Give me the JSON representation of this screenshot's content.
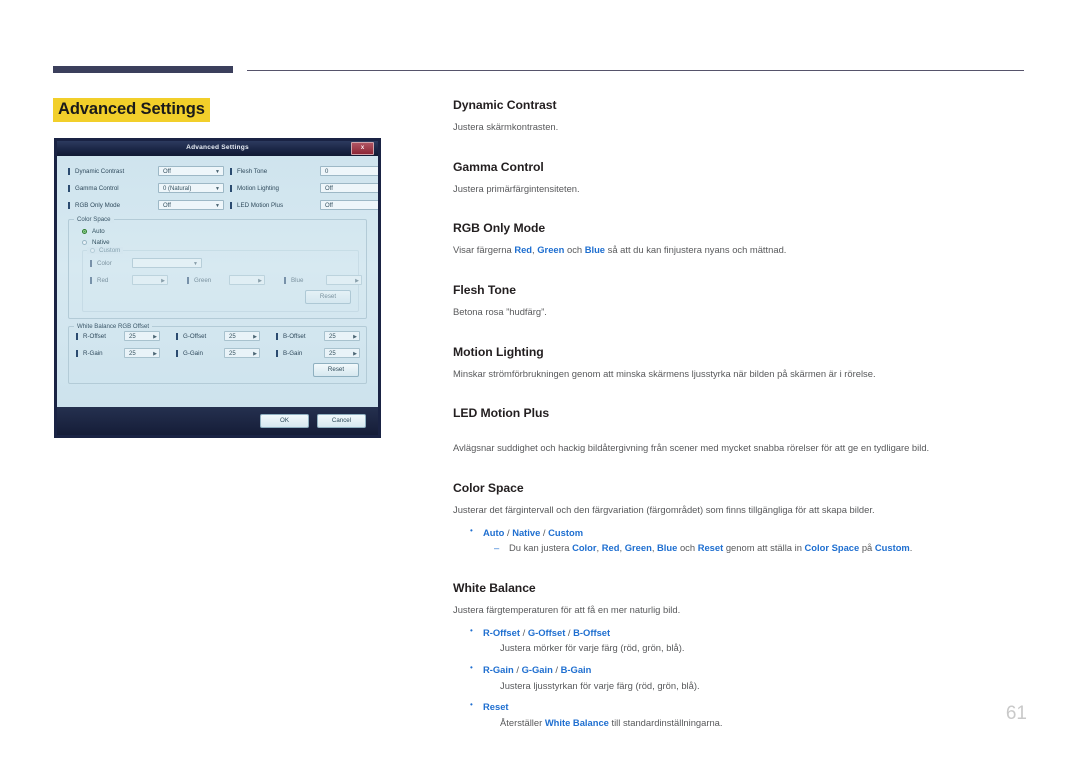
{
  "page": {
    "number": "61",
    "title": "Advanced Settings",
    "accent_highlight": "#f2cf2a",
    "link_color": "#1f6fd0",
    "rule_color": "#3b3f5c"
  },
  "osd": {
    "title": "Advanced Settings",
    "close_label": "x",
    "settings": [
      {
        "label": "Dynamic Contrast",
        "value": "Off"
      },
      {
        "label": "Flesh Tone",
        "value": "0"
      },
      {
        "label": "Gamma Control",
        "value": "0 (Natural)"
      },
      {
        "label": "Motion Lighting",
        "value": "Off"
      },
      {
        "label": "RGB Only Mode",
        "value": "Off"
      },
      {
        "label": "LED Motion Plus",
        "value": "Off"
      }
    ],
    "color_space": {
      "legend": "Color Space",
      "options": [
        {
          "label": "Auto",
          "selected": true
        },
        {
          "label": "Native",
          "selected": false
        },
        {
          "label": "Custom",
          "selected": false
        }
      ],
      "custom": {
        "legend": "Custom",
        "color_label": "Color",
        "color_value": "",
        "red_label": "Red",
        "red_value": "",
        "green_label": "Green",
        "green_value": "",
        "blue_label": "Blue",
        "blue_value": "",
        "reset_label": "Reset"
      }
    },
    "white_balance": {
      "legend": "White Balance RGB Offset",
      "fields": [
        {
          "label": "R-Offset",
          "value": "25"
        },
        {
          "label": "G-Offset",
          "value": "25"
        },
        {
          "label": "B-Offset",
          "value": "25"
        },
        {
          "label": "R-Gain",
          "value": "25"
        },
        {
          "label": "G-Gain",
          "value": "25"
        },
        {
          "label": "B-Gain",
          "value": "25"
        }
      ],
      "reset_label": "Reset"
    },
    "footer": {
      "ok_label": "OK",
      "cancel_label": "Cancel"
    }
  },
  "content": {
    "dynamic_contrast": {
      "heading": "Dynamic Contrast",
      "body": "Justera skärmkontrasten."
    },
    "gamma_control": {
      "heading": "Gamma Control",
      "body": "Justera primärfärgintensiteten."
    },
    "rgb_only_mode": {
      "heading": "RGB Only Mode",
      "body_pre": "Visar färgerna ",
      "red": "Red",
      "sep1": ", ",
      "green": "Green",
      "sep2": " och ",
      "blue": "Blue",
      "body_post": " så att du kan finjustera nyans och mättnad."
    },
    "flesh_tone": {
      "heading": "Flesh Tone",
      "body": "Betona rosa ”hudfärg”."
    },
    "motion_lighting": {
      "heading": "Motion Lighting",
      "body": "Minskar strömförbrukningen genom att minska skärmens ljusstyrka när bilden på skärmen är i rörelse."
    },
    "led_motion_plus": {
      "heading": "LED Motion Plus",
      "body": "Avlägsnar suddighet och hackig bildåtergivning från scener med mycket snabba rörelser för att ge en tydligare bild."
    },
    "color_space": {
      "heading": "Color Space",
      "body": "Justerar det färgintervall och den färgvariation (färgområdet) som finns tillgängliga för att skapa bilder.",
      "bullet": {
        "auto": "Auto",
        "native": "Native",
        "custom": "Custom",
        "slash": " / "
      },
      "sub_pre": "Du kan justera ",
      "sub_color": "Color",
      "sub_c1": ", ",
      "sub_red": "Red",
      "sub_c2": ", ",
      "sub_green": "Green",
      "sub_c3": ", ",
      "sub_blue": "Blue",
      "sub_mid": " och ",
      "sub_reset": "Reset",
      "sub_mid2": " genom att ställa in ",
      "sub_cs": "Color Space",
      "sub_mid3": " på ",
      "sub_custom": "Custom",
      "sub_end": "."
    },
    "white_balance": {
      "heading": "White Balance",
      "body": "Justera färgtemperaturen för att få en mer naturlig bild.",
      "offset_bullet": {
        "r": "R-Offset",
        "g": "G-Offset",
        "b": "B-Offset",
        "slash": " / "
      },
      "offset_desc": "Justera mörker för varje färg (röd, grön, blå).",
      "gain_bullet": {
        "r": "R-Gain",
        "g": "G-Gain",
        "b": "B-Gain",
        "slash": " / "
      },
      "gain_desc": "Justera ljusstyrkan för varje färg (röd, grön, blå).",
      "reset_bullet": "Reset",
      "reset_pre": "Återställer ",
      "reset_term": "White Balance",
      "reset_post": " till standardinställningarna."
    }
  }
}
